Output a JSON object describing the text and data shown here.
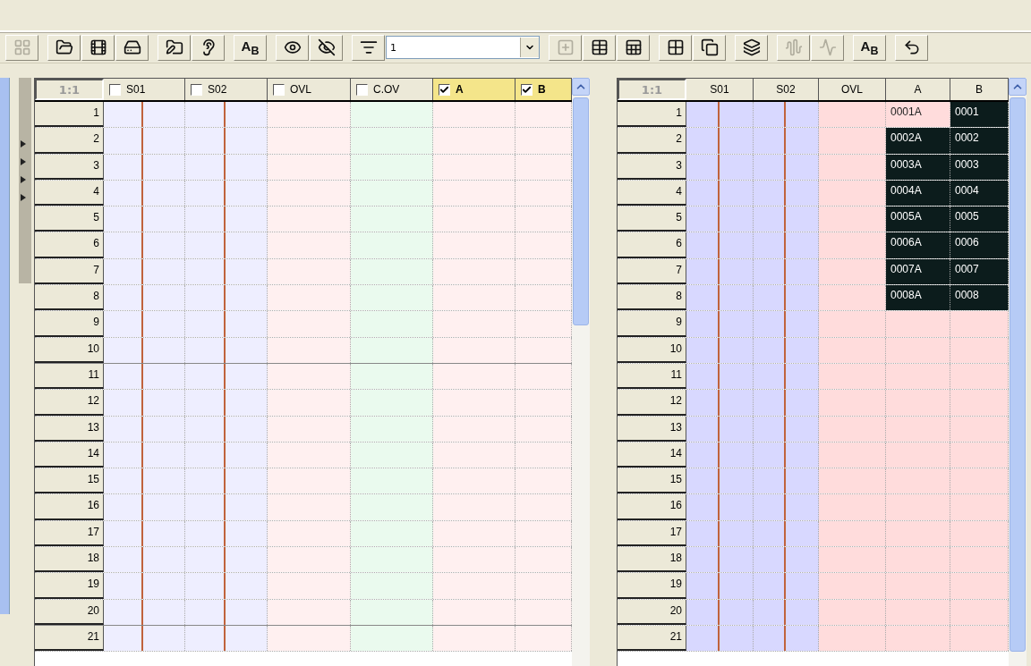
{
  "toolbar": {
    "groups": [
      [
        {
          "kind": "icon",
          "disabled": true
        }
      ],
      [
        {
          "kind": "icon",
          "disabled": false
        },
        {
          "kind": "icon",
          "disabled": false
        },
        {
          "kind": "icon",
          "disabled": false
        }
      ],
      [
        {
          "kind": "icon",
          "disabled": false
        },
        {
          "kind": "icon",
          "disabled": false
        }
      ],
      [
        {
          "kind": "text",
          "label": "A$_{B}$",
          "disabled": false
        }
      ],
      [
        {
          "kind": "icon",
          "disabled": false
        },
        {
          "kind": "icon",
          "disabled": false
        }
      ],
      [
        {
          "kind": "icon",
          "disabled": false
        },
        {
          "kind": "combo",
          "value": "1"
        }
      ],
      [
        {
          "kind": "icon",
          "disabled": true
        },
        {
          "kind": "icon",
          "disabled": false
        },
        {
          "kind": "icon",
          "disabled": false
        }
      ],
      [
        {
          "kind": "icon",
          "disabled": false
        },
        {
          "kind": "icon",
          "disabled": false
        }
      ],
      [
        {
          "kind": "icon",
          "disabled": false
        }
      ],
      [
        {
          "kind": "icon",
          "disabled": true
        },
        {
          "kind": "icon",
          "disabled": true
        }
      ],
      [
        {
          "kind": "text",
          "label": "A$_{B}$",
          "disabled": false
        }
      ],
      [
        {
          "kind": "icon",
          "disabled": false
        }
      ]
    ]
  },
  "left_grid": {
    "corner": "1:1",
    "columns": [
      {
        "label": "S01",
        "checked": false,
        "color": "#eeeeff",
        "marker": true
      },
      {
        "label": "S02",
        "checked": false,
        "color": "#eeeeff",
        "marker": true
      },
      {
        "label": "OVL",
        "checked": false,
        "color": "#fff0f0",
        "marker": false
      },
      {
        "label": "C.OV",
        "checked": false,
        "color": "#eafaee",
        "marker": false
      },
      {
        "label": "A",
        "checked": true,
        "color": "#fff0f0",
        "marker": false
      },
      {
        "label": "B",
        "checked": true,
        "color": "#fff0f0",
        "marker": false
      }
    ],
    "rows": [
      "1",
      "2",
      "3",
      "4",
      "5",
      "6",
      "7",
      "8",
      "9",
      "10",
      "11",
      "12",
      "13",
      "14",
      "15",
      "16",
      "17",
      "18",
      "19",
      "20",
      "21"
    ]
  },
  "right_grid": {
    "corner": "1:1",
    "columns": [
      {
        "label": "S01",
        "color": "#d8d8ff",
        "marker": true
      },
      {
        "label": "S02",
        "color": "#d8d8ff",
        "marker": true
      },
      {
        "label": "OVL",
        "color": "#ffdcdc",
        "marker": false
      },
      {
        "label": "A",
        "color": "#ffdcdc",
        "marker": false
      },
      {
        "label": "B",
        "color": "#ffdcdc",
        "marker": false
      }
    ],
    "rows": [
      {
        "number": "1",
        "cells": [
          {
            "text": "0001A",
            "selected": false
          },
          {
            "text": "0001",
            "selected": true
          }
        ]
      },
      {
        "number": "2",
        "cells": [
          {
            "text": "0002A",
            "selected": true
          },
          {
            "text": "0002",
            "selected": true
          }
        ]
      },
      {
        "number": "3",
        "cells": [
          {
            "text": "0003A",
            "selected": true
          },
          {
            "text": "0003",
            "selected": true
          }
        ]
      },
      {
        "number": "4",
        "cells": [
          {
            "text": "0004A",
            "selected": true
          },
          {
            "text": "0004",
            "selected": true
          }
        ]
      },
      {
        "number": "5",
        "cells": [
          {
            "text": "0005A",
            "selected": true
          },
          {
            "text": "0005",
            "selected": true
          }
        ]
      },
      {
        "number": "6",
        "cells": [
          {
            "text": "0006A",
            "selected": true
          },
          {
            "text": "0006",
            "selected": true
          }
        ]
      },
      {
        "number": "7",
        "cells": [
          {
            "text": "0007A",
            "selected": true
          },
          {
            "text": "0007",
            "selected": true
          }
        ]
      },
      {
        "number": "8",
        "cells": [
          {
            "text": "0008A",
            "selected": true
          },
          {
            "text": "0008",
            "selected": true
          }
        ]
      },
      {
        "number": "9"
      },
      {
        "number": "10"
      },
      {
        "number": "11"
      },
      {
        "number": "12"
      },
      {
        "number": "13"
      },
      {
        "number": "14"
      },
      {
        "number": "15"
      },
      {
        "number": "16"
      },
      {
        "number": "17"
      },
      {
        "number": "18"
      },
      {
        "number": "19"
      },
      {
        "number": "20"
      },
      {
        "number": "21"
      }
    ]
  }
}
